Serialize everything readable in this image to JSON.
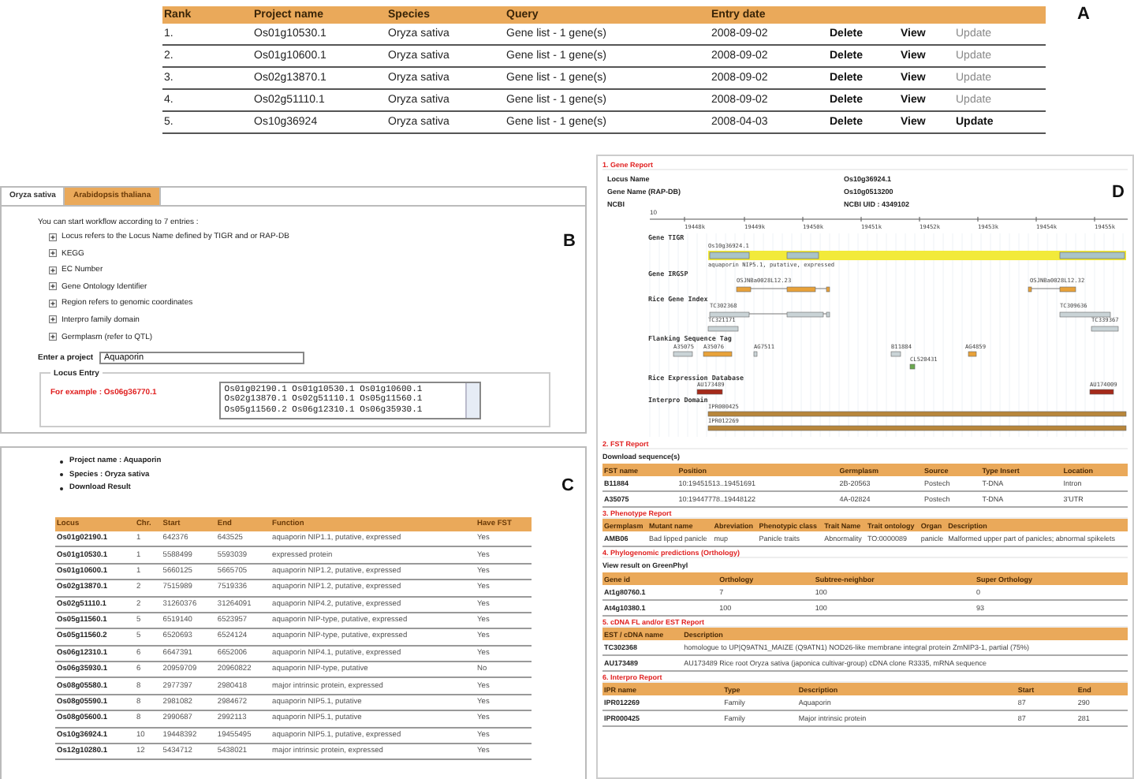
{
  "panel_a": {
    "label": "A",
    "columns": [
      "Rank",
      "Project name",
      "Species",
      "Query",
      "Entry date"
    ],
    "rows": [
      {
        "rank": "1.",
        "project": "Os01g10530.1",
        "species": "Oryza sativa",
        "query": "Gene list - 1 gene(s)",
        "date": "2008-09-02",
        "actions": [
          "Delete",
          "View",
          "Update"
        ],
        "update_disabled": true
      },
      {
        "rank": "2.",
        "project": "Os01g10600.1",
        "species": "Oryza sativa",
        "query": "Gene list - 1 gene(s)",
        "date": "2008-09-02",
        "actions": [
          "Delete",
          "View",
          "Update"
        ],
        "update_disabled": true
      },
      {
        "rank": "3.",
        "project": "Os02g13870.1",
        "species": "Oryza sativa",
        "query": "Gene list - 1 gene(s)",
        "date": "2008-09-02",
        "actions": [
          "Delete",
          "View",
          "Update"
        ],
        "update_disabled": true
      },
      {
        "rank": "4.",
        "project": "Os02g51110.1",
        "species": "Oryza sativa",
        "query": "Gene list - 1 gene(s)",
        "date": "2008-09-02",
        "actions": [
          "Delete",
          "View",
          "Update"
        ],
        "update_disabled": true
      },
      {
        "rank": "5.",
        "project": "Os10g36924",
        "species": "Oryza sativa",
        "query": "Gene list - 1 gene(s)",
        "date": "2008-04-03",
        "actions": [
          "Delete",
          "View",
          "Update"
        ],
        "update_disabled": false
      }
    ]
  },
  "panel_b": {
    "label": "B",
    "tabs": [
      {
        "label": "Oryza sativa",
        "selected": true
      },
      {
        "label": "Arabidopsis thaliana",
        "selected": false
      }
    ],
    "intro": "You can start workflow according to 7 entries :",
    "entries": [
      {
        "label": "Locus refers to the Locus Name defined by TIGR and or RAP-DB",
        "expanded": false
      },
      {
        "label": "KEGG",
        "expanded": false
      },
      {
        "label": "EC Number",
        "expanded": false
      },
      {
        "label": "Gene Ontology Identifier",
        "expanded": false
      },
      {
        "label": "Region refers to genomic coordinates",
        "expanded": false
      },
      {
        "label": "Interpro family domain",
        "expanded": false
      },
      {
        "label": "Germplasm (refer to QTL)",
        "expanded": false
      }
    ],
    "project_label": "Enter a project",
    "project_value": "Aquaporin",
    "locus_entry": {
      "legend": "Locus Entry",
      "example": "For example : Os06g36770.1",
      "lines": [
        "Os01g02190.1 Os01g10530.1 Os01g10600.1",
        "Os02g13870.1 Os02g51110.1 Os05g11560.1",
        "Os05g11560.2 Os06g12310.1 Os06g35930.1"
      ]
    }
  },
  "panel_c": {
    "label": "C",
    "bullets": [
      "Project name : Aquaporin",
      "Species : Oryza sativa",
      "Download Result"
    ],
    "columns": [
      "Locus",
      "Chr.",
      "Start",
      "End",
      "Function",
      "Have FST"
    ],
    "rows": [
      [
        "Os01g02190.1",
        "1",
        "642376",
        "643525",
        "aquaporin NIP1.1, putative, expressed",
        "Yes"
      ],
      [
        "Os01g10530.1",
        "1",
        "5588499",
        "5593039",
        "expressed protein",
        "Yes"
      ],
      [
        "Os01g10600.1",
        "1",
        "5660125",
        "5665705",
        "aquaporin NIP1.2, putative, expressed",
        "Yes"
      ],
      [
        "Os02g13870.1",
        "2",
        "7515989",
        "7519336",
        "aquaporin NIP1.2, putative, expressed",
        "Yes"
      ],
      [
        "Os02g51110.1",
        "2",
        "31260376",
        "31264091",
        "aquaporin NIP4.2, putative, expressed",
        "Yes"
      ],
      [
        "Os05g11560.1",
        "5",
        "6519140",
        "6523957",
        "aquaporin NIP-type, putative, expressed",
        "Yes"
      ],
      [
        "Os05g11560.2",
        "5",
        "6520693",
        "6524124",
        "aquaporin NIP-type, putative, expressed",
        "Yes"
      ],
      [
        "Os06g12310.1",
        "6",
        "6647391",
        "6652006",
        "aquaporin NIP4.1, putative, expressed",
        "Yes"
      ],
      [
        "Os06g35930.1",
        "6",
        "20959709",
        "20960822",
        "aquaporin NIP-type, putative",
        "No"
      ],
      [
        "Os08g05580.1",
        "8",
        "2977397",
        "2980418",
        "major intrinsic protein, expressed",
        "Yes"
      ],
      [
        "Os08g05590.1",
        "8",
        "2981082",
        "2984672",
        "aquaporin NIP5.1, putative",
        "Yes"
      ],
      [
        "Os08g05600.1",
        "8",
        "2990687",
        "2992113",
        "aquaporin NIP5.1, putative",
        "Yes"
      ],
      [
        "Os10g36924.1",
        "10",
        "19448392",
        "19455495",
        "aquaporin NIP5.1, putative, expressed",
        "Yes"
      ],
      [
        "Os12g10280.1",
        "12",
        "5434712",
        "5438021",
        "major intrinsic protein, expressed",
        "Yes"
      ]
    ]
  },
  "panel_d": {
    "label": "D",
    "gene_report": {
      "title": "1. Gene Report",
      "fields": [
        {
          "label": "Locus Name",
          "value": "Os10g36924.1"
        },
        {
          "label": "Gene Name (RAP-DB)",
          "value": "Os10g0513200"
        },
        {
          "label": "NCBI",
          "value": "NCBI UID : 4349102"
        }
      ],
      "browser": {
        "scale": "10",
        "ticks": [
          "19448k",
          "19449k",
          "19450k",
          "19451k",
          "19452k",
          "19453k",
          "19454k",
          "19455k"
        ],
        "tracks": [
          {
            "label": "Gene TIGR",
            "features": [
              {
                "label": "Os10g36924.1",
                "color": "#a9c4c8",
                "note": "aquaporin NIP5.1, putative, expressed"
              }
            ]
          },
          {
            "label": "Gene IRGSP",
            "features": [
              {
                "label": "OSJNBa0028L12.23",
                "color": "#e8a23a"
              },
              {
                "label": "OSJNBa0028L12.32",
                "color": "#e8a23a"
              }
            ]
          },
          {
            "label": "Rice Gene Index",
            "features": [
              {
                "label": "TC302368",
                "color": "#c9d3d6"
              },
              {
                "label": "TC309636",
                "color": "#c9d3d6"
              },
              {
                "label": "TC321171",
                "color": "#c9d3d6"
              },
              {
                "label": "TC339367",
                "color": "#c9d3d6"
              }
            ]
          },
          {
            "label": "Flanking Sequence Tag",
            "features": [
              {
                "label": "A35075",
                "color": "#c9d3d6"
              },
              {
                "label": "A35076",
                "color": "#e8a23a"
              },
              {
                "label": "AG7511",
                "color": "#c9d3d6"
              },
              {
                "label": "B11884",
                "color": "#c9d3d6"
              },
              {
                "label": "AG4859",
                "color": "#e8a23a"
              },
              {
                "label": "CL520431",
                "color": "#6aa84f"
              }
            ]
          },
          {
            "label": "Rice Expression Database",
            "features": [
              {
                "label": "AU173489",
                "color": "#a52a1a"
              },
              {
                "label": "AU174009",
                "color": "#a52a1a"
              }
            ]
          },
          {
            "label": "Interpro Domain",
            "features": [
              {
                "label": "IPR000425",
                "color": "#b8863b"
              },
              {
                "label": "IPR012269",
                "color": "#b8863b"
              }
            ]
          }
        ]
      }
    },
    "sections": [
      {
        "title": "2. FST Report",
        "subtitle": "Download sequence(s)",
        "columns": [
          "FST name",
          "Position",
          "Germplasm",
          "Source",
          "Type Insert",
          "Location"
        ],
        "rows": [
          [
            "B11884",
            "10:19451513..19451691",
            "2B-20563",
            "Postech",
            "T-DNA",
            "Intron"
          ],
          [
            "A35075",
            "10:19447778..19448122",
            "4A-02824",
            "Postech",
            "T-DNA",
            "3'UTR"
          ]
        ]
      },
      {
        "title": "3. Phenotype Report",
        "columns": [
          "Germplasm",
          "Mutant name",
          "Abreviation",
          "Phenotypic class",
          "Trait Name",
          "Trait ontology",
          "Organ",
          "Description"
        ],
        "rows": [
          [
            "AMB06",
            "Bad lipped panicle",
            "mup",
            "Panicle traits",
            "Abnormality",
            "TO:0000089",
            "panicle",
            "Malformed upper part of panicles; abnormal spikelets"
          ]
        ]
      },
      {
        "title": "4. Phylogenomic predictions (Orthology)",
        "subtitle": "View result on GreenPhyl",
        "columns": [
          "Gene id",
          "Orthology",
          "Subtree-neighbor",
          "Super Orthology"
        ],
        "rows": [
          [
            "At1g80760.1",
            "7",
            "100",
            "0"
          ],
          [
            "At4g10380.1",
            "100",
            "100",
            "93"
          ]
        ]
      },
      {
        "title": "5. cDNA FL and/or EST Report",
        "columns": [
          "EST / cDNA name",
          "Description"
        ],
        "rows": [
          [
            "TC302368",
            "homologue to UP|Q9ATN1_MAIZE (Q9ATN1) NOD26-like membrane integral protein ZmNIP3-1, partial (75%)"
          ],
          [
            "AU173489",
            "AU173489 Rice root Oryza sativa (japonica cultivar-group) cDNA clone R3335, mRNA sequence"
          ]
        ]
      },
      {
        "title": "6. Interpro Report",
        "columns": [
          "IPR name",
          "Type",
          "Description",
          "Start",
          "End"
        ],
        "rows": [
          [
            "IPR012269",
            "Family",
            "Aquaporin",
            "87",
            "290"
          ],
          [
            "IPR000425",
            "Family",
            "Major intrinsic protein",
            "87",
            "281"
          ]
        ]
      }
    ]
  }
}
